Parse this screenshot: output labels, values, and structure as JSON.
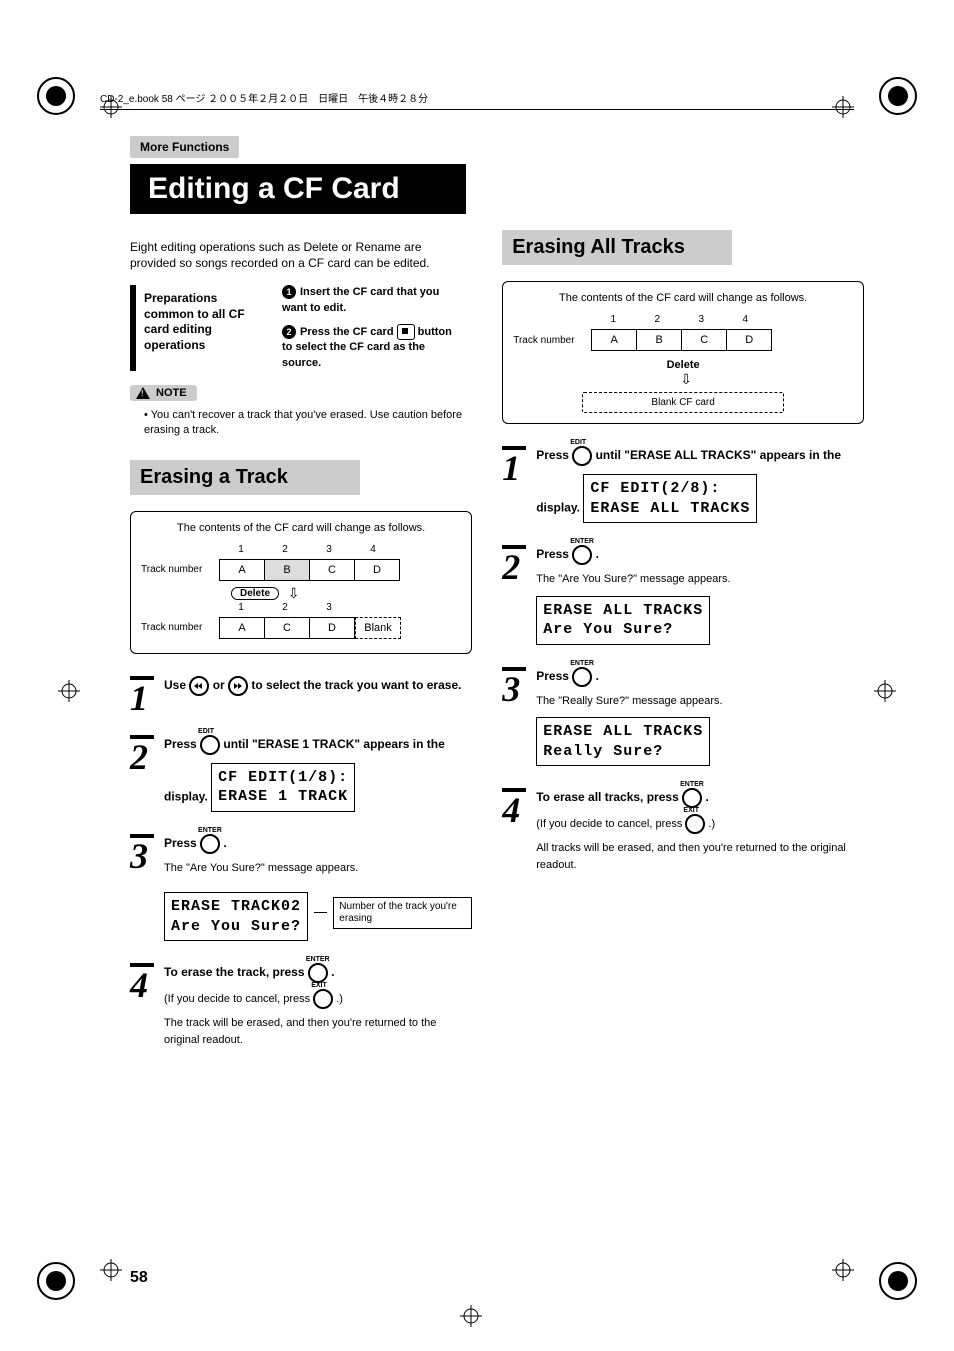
{
  "header": {
    "file_info": "CD-2_e.book  58 ページ  ２００５年２月２０日　日曜日　午後４時２８分"
  },
  "breadcrumb": "More Functions",
  "title": "Editing a CF Card",
  "intro": "Eight editing operations such as Delete or Rename are provided so songs recorded on a CF card can be edited.",
  "prep": {
    "heading": "Preparations common to all CF card editing operations",
    "item1": "Insert the CF card that you want to edit.",
    "item2a": "Press the CF card",
    "item2b": "button to select the CF card as the source."
  },
  "note": {
    "label": "NOTE",
    "text": "You can't recover a track that you've erased. Use caution before erasing a track."
  },
  "sections": {
    "erase_track": "Erasing a Track",
    "erase_all": "Erasing All Tracks"
  },
  "diagram": {
    "caption": "The contents of the CF card will change as follows.",
    "track_label": "Track number",
    "nums": [
      "1",
      "2",
      "3",
      "4"
    ],
    "nums3": [
      "1",
      "2",
      "3"
    ],
    "row1": [
      "A",
      "B",
      "C",
      "D"
    ],
    "row2": [
      "A",
      "C",
      "D"
    ],
    "blank_label": "Blank",
    "delete_label": "Delete",
    "blank_card": "Blank CF card"
  },
  "labels": {
    "edit": "EDIT",
    "enter": "ENTER",
    "exit": "EXIT"
  },
  "left_steps": {
    "s1": "Use          or          to select the track you want to erase.",
    "s1a": "Use ",
    "s1b": " or ",
    "s1c": " to select the track you want to erase.",
    "s2a": "Press ",
    "s2b": " until \"ERASE 1 TRACK\" appears in the display.",
    "lcd2_l1": "CF EDIT(1/8):",
    "lcd2_l2": "ERASE 1 TRACK",
    "s3a": "Press ",
    "s3b": " .",
    "s3_sub": "The \"Are You Sure?\" message appears.",
    "lcd3_l1": "ERASE TRACK02",
    "lcd3_l2": "Are You Sure?",
    "callout": "Number of the track you're erasing",
    "s4a": "To erase the track, press ",
    "s4b": " .",
    "s4_sub1a": "(If you decide to cancel, press ",
    "s4_sub1b": " .)",
    "s4_sub2": "The track will be erased, and then you're returned to the original readout."
  },
  "right_steps": {
    "s1a": "Press ",
    "s1b": " until \"ERASE ALL TRACKS\" appears in the display.",
    "lcd1_l1": "CF EDIT(2/8):",
    "lcd1_l2": "ERASE ALL TRACKS",
    "s2a": "Press ",
    "s2b": " .",
    "s2_sub": "The \"Are You Sure?\" message appears.",
    "lcd2_l1": "ERASE ALL TRACKS",
    "lcd2_l2": "Are You Sure?",
    "s3a": "Press ",
    "s3b": " .",
    "s3_sub": "The \"Really Sure?\" message appears.",
    "lcd3_l1": "ERASE ALL TRACKS",
    "lcd3_l2": "Really Sure?",
    "s4a": "To erase all tracks, press ",
    "s4b": " .",
    "s4_sub1a": "(If you decide to cancel, press ",
    "s4_sub1b": " .)",
    "s4_sub2": "All tracks will be erased, and then you're returned to the original readout."
  },
  "page_number": "58"
}
